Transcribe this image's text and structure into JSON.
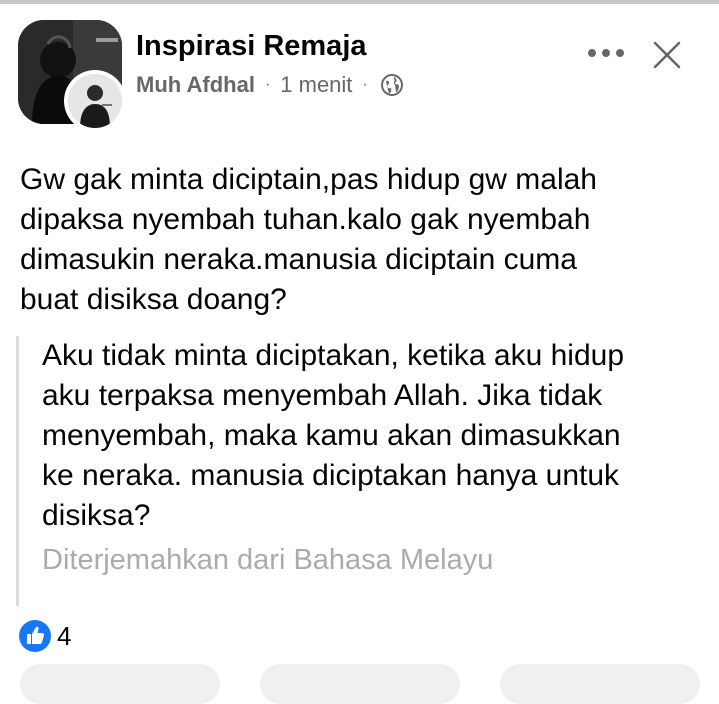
{
  "header": {
    "group_name": "Inspirasi Remaja",
    "author": "Muh Afdhal",
    "separator": "·",
    "time": "1 menit",
    "privacy_icon": "globe-icon"
  },
  "post": {
    "text_lines": [
      "Gw gak minta diciptain,pas hidup gw malah",
      "dipaksa nyembah tuhan.kalo gak nyembah",
      "dimasukin neraka.manusia diciptain cuma",
      "buat disiksa doang?"
    ],
    "translation_lines": [
      "Aku tidak minta diciptakan, ketika aku hidup",
      "aku terpaksa menyembah Allah. Jika tidak",
      "menyembah, maka kamu akan dimasukkan",
      "ke neraka. manusia diciptakan hanya untuk",
      "disiksa?"
    ],
    "translation_note": "Diterjemahkan dari Bahasa Melayu"
  },
  "reactions": {
    "icon": "like-icon",
    "count": "4"
  },
  "colors": {
    "like_blue": "#1877f2",
    "meta_gray": "#65676b",
    "note_gray": "#a8abaf"
  }
}
